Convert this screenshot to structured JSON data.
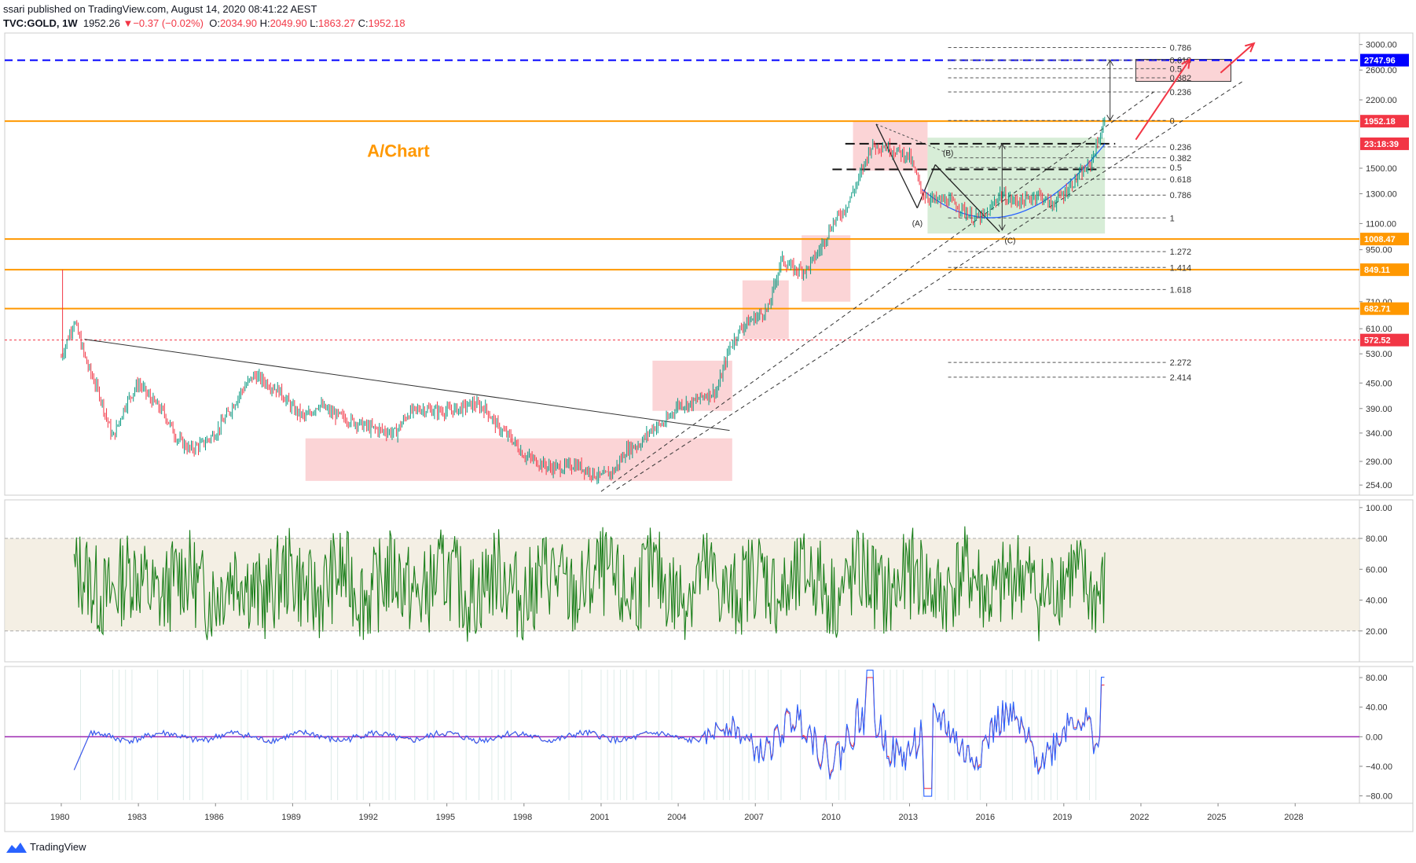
{
  "header": {
    "publisher": "ssari published on TradingView.com, August 14, 2020 08:41:22 AEST",
    "symbol": "TVC:GOLD, 1W",
    "last": "1952.26",
    "change_arrow": "▼",
    "change": "−0.37 (−0.02%)",
    "o_label": "O:",
    "o_value": "2034.90",
    "h_label": "H:",
    "h_value": "2049.90",
    "l_label": "L:",
    "l_value": "1863.27",
    "c_label": "C:",
    "c_value": "1952.18"
  },
  "annotation": {
    "chart_label": "A/Chart"
  },
  "footer": {
    "brand": "TradingView"
  },
  "colors": {
    "orange": "#ff9800",
    "blue": "#0000ff",
    "candle_up": "#089981",
    "candle_down": "#f23645",
    "rsi_green": "#1b7f1b",
    "macd_blue": "#2962ff",
    "macd_red": "#f23645",
    "zone_red": "#f7a9ad",
    "zone_green": "#b7dfb7"
  },
  "chart_data": [
    {
      "type": "candlestick",
      "pane": "price",
      "y_scale": "log",
      "ylim": [
        240,
        3200
      ],
      "x_ticks": [
        "1980",
        "1983",
        "1986",
        "1989",
        "1992",
        "1995",
        "1998",
        "2001",
        "2004",
        "2007",
        "2010",
        "2013",
        "2016",
        "2019",
        "2022",
        "2025",
        "2028"
      ],
      "y_ticks": [
        "3000.00",
        "2600.00",
        "2200.00",
        "1952.18",
        "1500.00",
        "1300.00",
        "1100.00",
        "1008.47",
        "950.00",
        "849.11",
        "710.00",
        "682.71",
        "610.00",
        "572.52",
        "530.00",
        "450.00",
        "390.00",
        "340.00",
        "290.00",
        "254.00"
      ],
      "price_labels": [
        {
          "value": "2747.96",
          "color": "#0000ff"
        },
        {
          "value": "1952.18",
          "color": "#f23645"
        },
        {
          "value": "23:18:39",
          "color": "#f23645"
        },
        {
          "value": "1008.47",
          "color": "#ff9800"
        },
        {
          "value": "849.11",
          "color": "#ff9800"
        },
        {
          "value": "682.71",
          "color": "#ff9800"
        },
        {
          "value": "572.52",
          "color": "#f23645"
        }
      ],
      "horizontal_levels": [
        2747.96,
        1952.18,
        1008.47,
        849.11,
        682.71,
        572.52
      ],
      "fib_upper": [
        {
          "label": "0.786",
          "value": 2950
        },
        {
          "label": "0.618",
          "value": 2750
        },
        {
          "label": "0.5",
          "value": 2620
        },
        {
          "label": "0.382",
          "value": 2490
        },
        {
          "label": "0.236",
          "value": 2300
        },
        {
          "label": "0",
          "value": 1960
        }
      ],
      "fib_lower": [
        {
          "label": "0.236",
          "value": 1690
        },
        {
          "label": "0.382",
          "value": 1590
        },
        {
          "label": "0.5",
          "value": 1505
        },
        {
          "label": "0.618",
          "value": 1410
        },
        {
          "label": "0.786",
          "value": 1290
        },
        {
          "label": "1",
          "value": 1135
        },
        {
          "label": "1.272",
          "value": 940
        },
        {
          "label": "1.414",
          "value": 860
        },
        {
          "label": "1.618",
          "value": 760
        },
        {
          "label": "2.272",
          "value": 505
        },
        {
          "label": "2.414",
          "value": 465
        }
      ],
      "wave_labels": [
        "(A)",
        "(B)",
        "(C)"
      ],
      "series": [
        {
          "name": "",
          "x": [
            1980.0,
            1980.5,
            1981.0,
            1981.5,
            1982.0,
            1982.5,
            1983.0,
            1983.5,
            1984.0,
            1984.5,
            1985.0,
            1985.5,
            1986.0,
            1986.5,
            1987.0,
            1987.5,
            1988.0,
            1988.5,
            1989.0,
            1989.5,
            1990.0,
            1990.5,
            1991.0,
            1991.5,
            1992.0,
            1992.5,
            1993.0,
            1993.5,
            1994.0,
            1994.5,
            1995.0,
            1995.5,
            1996.0,
            1996.5,
            1997.0,
            1997.5,
            1998.0,
            1998.5,
            1999.0,
            1999.5,
            2000.0,
            2000.5,
            2001.0,
            2001.5,
            2002.0,
            2002.5,
            2003.0,
            2003.5,
            2004.0,
            2004.5,
            2005.0,
            2005.5,
            2006.0,
            2006.5,
            2007.0,
            2007.5,
            2008.0,
            2008.5,
            2009.0,
            2009.5,
            2010.0,
            2010.5,
            2011.0,
            2011.5,
            2012.0,
            2012.5,
            2013.0,
            2013.5,
            2014.0,
            2014.5,
            2015.0,
            2015.5,
            2016.0,
            2016.5,
            2017.0,
            2017.5,
            2018.0,
            2018.5,
            2019.0,
            2019.5,
            2020.0,
            2020.6
          ],
          "y": [
            520,
            640,
            500,
            420,
            330,
            400,
            450,
            410,
            380,
            330,
            310,
            320,
            340,
            380,
            430,
            470,
            450,
            430,
            390,
            370,
            400,
            380,
            370,
            360,
            350,
            345,
            340,
            380,
            390,
            385,
            385,
            390,
            400,
            390,
            350,
            330,
            300,
            290,
            280,
            280,
            285,
            275,
            265,
            275,
            310,
            320,
            350,
            360,
            400,
            400,
            420,
            430,
            550,
            620,
            650,
            680,
            900,
            850,
            850,
            950,
            1100,
            1200,
            1400,
            1700,
            1700,
            1650,
            1600,
            1300,
            1250,
            1250,
            1200,
            1130,
            1150,
            1300,
            1250,
            1250,
            1300,
            1220,
            1300,
            1420,
            1520,
            1952
          ]
        }
      ]
    },
    {
      "type": "line",
      "pane": "oscillator",
      "ylim": [
        0,
        105
      ],
      "y_ticks": [
        "100.00",
        "80.00",
        "60.00",
        "40.00",
        "20.00"
      ],
      "band": [
        20,
        80
      ],
      "series": [
        {
          "name": "",
          "x": [
            1980.5,
            2020.6
          ],
          "y": [
            50,
            80
          ]
        }
      ]
    },
    {
      "type": "line",
      "pane": "macd",
      "ylim": [
        -90,
        95
      ],
      "y_ticks": [
        "80.00",
        "40.00",
        "0.00",
        "−40.00",
        "−80.00"
      ],
      "series": [
        {
          "name": "",
          "x": [
            1980.5,
            2011.5,
            2013.8,
            2020.6
          ],
          "y": [
            -50,
            85,
            -75,
            75
          ]
        },
        {
          "name": "",
          "x": [
            1980.5,
            2011.5,
            2013.8,
            2020.6
          ],
          "y": [
            -40,
            70,
            -60,
            45
          ]
        }
      ]
    }
  ]
}
